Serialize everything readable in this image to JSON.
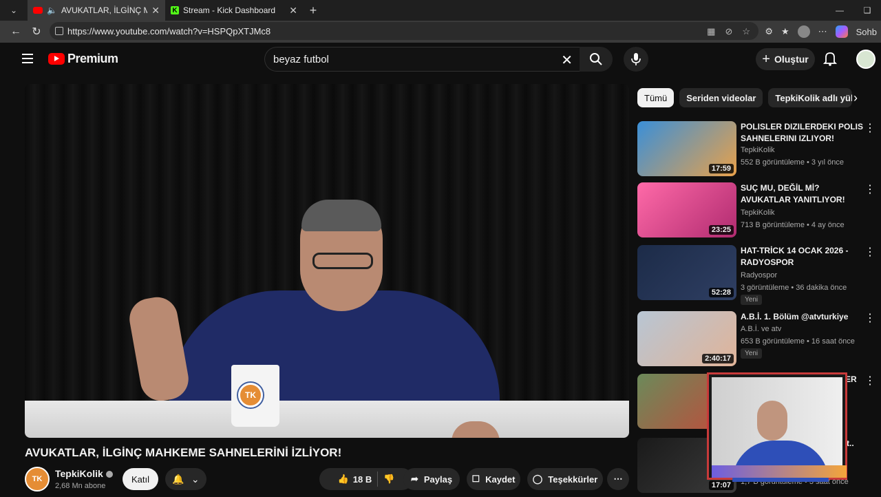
{
  "browser": {
    "tabs": [
      {
        "title": "AVUKATLAR, İLGİNÇ MAHKEM"
      },
      {
        "title": "Stream - Kick Dashboard"
      }
    ],
    "url": "https://www.youtube.com/watch?v=HSPQpXTJMc8",
    "copilot_label": "Sohb"
  },
  "header": {
    "logo_text": "Premium",
    "search_value": "beyaz futbol",
    "create_label": "Oluştur"
  },
  "video": {
    "title": "AVUKATLAR, İLGİNÇ MAHKEME SAHNELERİNİ İZLİYOR!",
    "mug_logo": "TK",
    "channel_name": "TepkiKolik",
    "channel_avatar": "TK",
    "subscribers": "2,68 Mn abone",
    "join_label": "Katıl",
    "like_count": "18 B",
    "share_label": "Paylaş",
    "save_label": "Kaydet",
    "thanks_label": "Teşekkürler"
  },
  "chips": [
    "Tümü",
    "Seriden videolar",
    "TepkiKolik adlı yükle"
  ],
  "recommendations": [
    {
      "title": "POLISLER DIZILERDEKI POLIS SAHNELERINI IZLIYOR!",
      "channel": "TepkiKolik",
      "meta": "552 B görüntüleme • 3 yıl önce",
      "duration": "17:59"
    },
    {
      "title": "SUÇ MU, DEĞİL Mİ? AVUKATLAR YANITLIYOR!",
      "channel": "TepkiKolik",
      "meta": "713 B görüntüleme • 4 ay önce",
      "duration": "23:25"
    },
    {
      "title": "HAT-TRİCK 14 OCAK 2026 - RADYOSPOR",
      "channel": "Radyospor",
      "meta": "3 görüntüleme • 36 dakika önce",
      "duration": "52:28",
      "badge": "Yeni"
    },
    {
      "title": "A.B.İ. 1. Bölüm @atvturkiye",
      "channel": "A.B.İ. ve atv",
      "meta": "653 B görüntüleme • 16 saat önce",
      "duration": "2:40:17",
      "badge": "Yeni"
    },
    {
      "title": "ER",
      "channel": "",
      "meta": "",
      "duration": ""
    },
    {
      "title": "t..",
      "channel": "",
      "meta": "1,7 B görüntüleme • 3 saat önce",
      "duration": "17:07"
    }
  ]
}
